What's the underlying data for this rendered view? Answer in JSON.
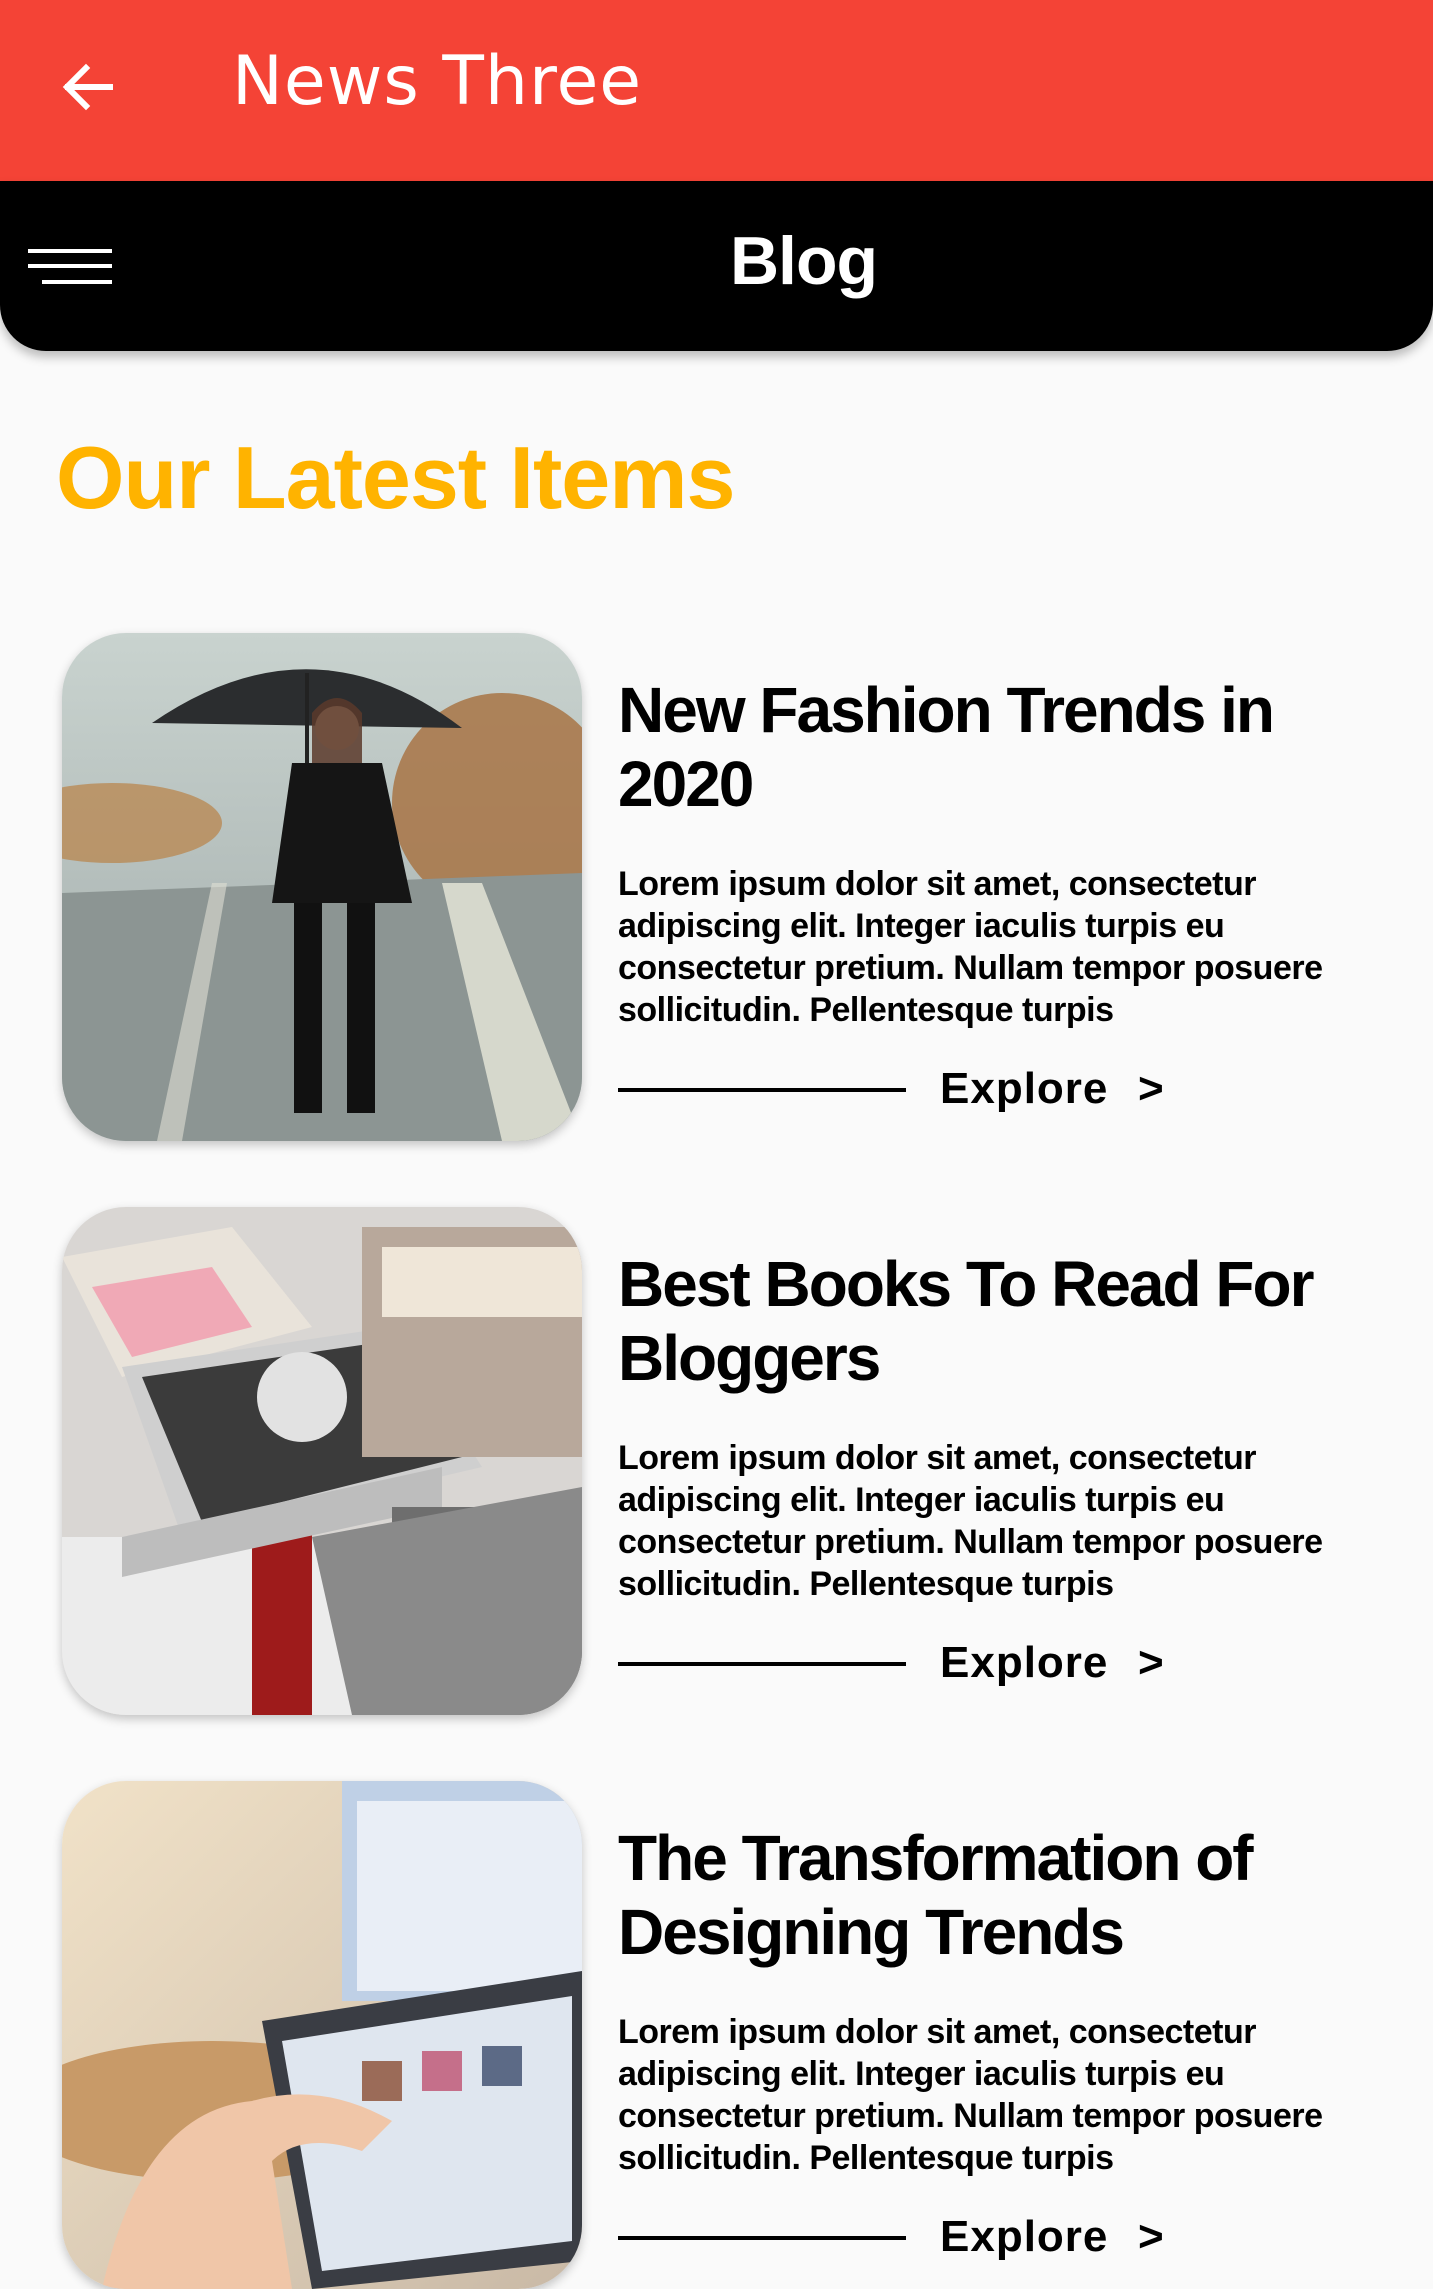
{
  "appbar": {
    "title": "News Three"
  },
  "blogbar": {
    "title": "Blog"
  },
  "section": {
    "title": "Our Latest Items"
  },
  "posts": [
    {
      "title": "New Fashion Trends in 2020",
      "body": "Lorem ipsum dolor sit amet, consectetur adipiscing elit. Integer iaculis turpis eu consectetur pretium. Nullam tempor posuere sollicitudin. Pellentesque turpis",
      "cta": "Explore",
      "chevron": ">"
    },
    {
      "title": "Best Books To Read For Bloggers",
      "body": "Lorem ipsum dolor sit amet, consectetur adipiscing elit. Integer iaculis turpis eu consectetur pretium. Nullam tempor posuere sollicitudin. Pellentesque turpis",
      "cta": "Explore",
      "chevron": ">"
    },
    {
      "title": "The Transformation of Designing Trends",
      "body": "Lorem ipsum dolor sit amet, consectetur adipiscing elit. Integer iaculis turpis eu consectetur pretium. Nullam tempor posuere sollicitudin. Pellentesque turpis",
      "cta": "Explore",
      "chevron": ">"
    }
  ],
  "colors": {
    "appbar": "#f44336",
    "blogbar": "#000000",
    "accent": "#ffb300"
  },
  "icons": {
    "back": "arrow-left-icon",
    "menu": "hamburger-menu-icon"
  }
}
